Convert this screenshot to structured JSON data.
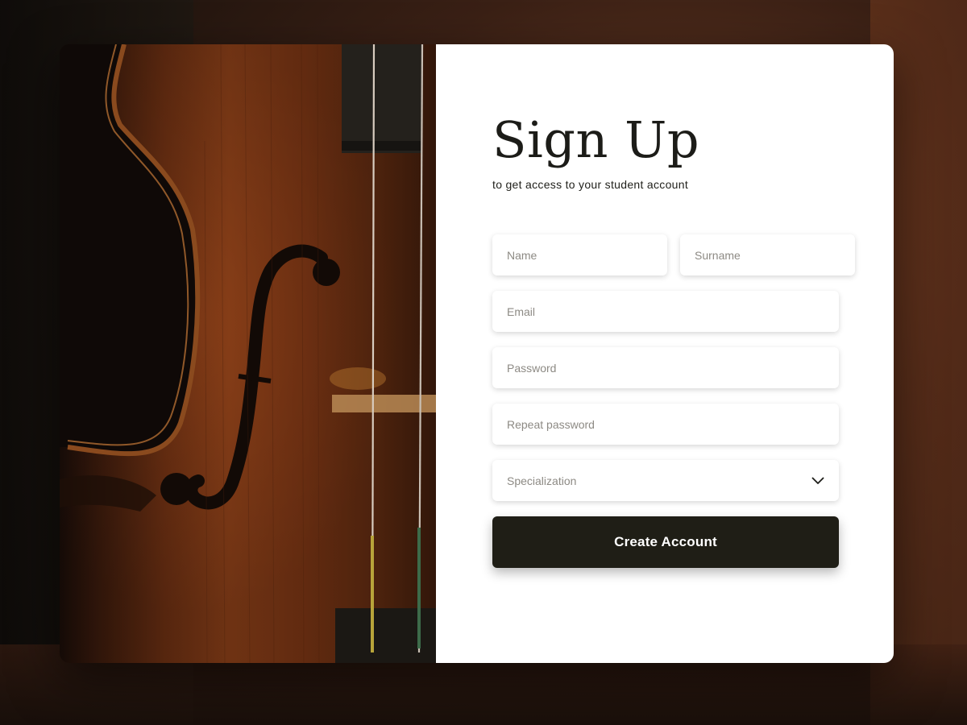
{
  "form": {
    "title": "Sign Up",
    "subtitle": "to get access to your student account",
    "fields": {
      "name_placeholder": "Name",
      "surname_placeholder": "Surname",
      "email_placeholder": "Email",
      "password_placeholder": "Password",
      "repeat_password_placeholder": "Repeat password"
    },
    "specialization": {
      "label": "Specialization",
      "icon": "chevron-down-icon"
    },
    "submit_label": "Create Account"
  },
  "colors": {
    "button_bg": "#1f1e16",
    "panel_bg": "#ffffff",
    "placeholder": "#8d8a84",
    "title_text": "#1c1c18"
  }
}
